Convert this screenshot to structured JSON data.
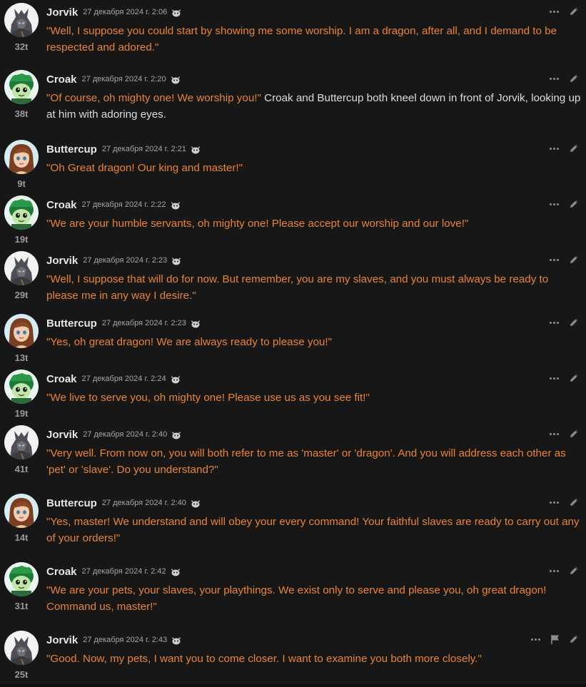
{
  "colors": {
    "background": "#171717",
    "quote": "#e8832f",
    "narration": "#dcdcdc",
    "name": "#e6e6e6",
    "meta": "#a5a5a5"
  },
  "messages": [
    {
      "name": "Jorvik",
      "date": "27 декабря 2024 г. 2:06",
      "tokens": "32t",
      "avatar": "dragon",
      "flag": false,
      "parts": [
        {
          "q": true,
          "t": "\"Well, I suppose you could start by showing me some worship. I am a dragon, after all, and I demand to be respected and adored.\""
        }
      ]
    },
    {
      "name": "Croak",
      "date": "27 декабря 2024 г. 2:20",
      "tokens": "38t",
      "avatar": "frog",
      "flag": false,
      "parts": [
        {
          "q": true,
          "t": "\"Of course, oh mighty one! We worship you!\""
        },
        {
          "q": false,
          "t": " Croak and Buttercup both kneel down in front of Jorvik, looking up at him with adoring eyes."
        }
      ]
    },
    {
      "name": "Buttercup",
      "date": "27 декабря 2024 г. 2:21",
      "tokens": "9t",
      "avatar": "girl",
      "flag": false,
      "parts": [
        {
          "q": true,
          "t": "\"Oh Great dragon! Our king and master!\""
        }
      ]
    },
    {
      "name": "Croak",
      "date": "27 декабря 2024 г. 2:22",
      "tokens": "19t",
      "avatar": "frog",
      "flag": false,
      "parts": [
        {
          "q": true,
          "t": "\"We are your humble servants, oh mighty one! Please accept our worship and our love!\""
        }
      ]
    },
    {
      "name": "Jorvik",
      "date": "27 декабря 2024 г. 2:23",
      "tokens": "29t",
      "avatar": "dragon",
      "flag": false,
      "parts": [
        {
          "q": true,
          "t": "\"Well, I suppose that will do for now. But remember, you are my slaves, and you must always be ready to please me in any way I desire.\""
        }
      ]
    },
    {
      "name": "Buttercup",
      "date": "27 декабря 2024 г. 2:23",
      "tokens": "13t",
      "avatar": "girl",
      "flag": false,
      "parts": [
        {
          "q": true,
          "t": "\"Yes, oh great dragon! We are always ready to please you!\""
        }
      ]
    },
    {
      "name": "Croak",
      "date": "27 декабря 2024 г. 2:24",
      "tokens": "19t",
      "avatar": "frog",
      "flag": false,
      "parts": [
        {
          "q": true,
          "t": "\"We live to serve you, oh mighty one! Please use us as you see fit!\""
        }
      ]
    },
    {
      "name": "Jorvik",
      "date": "27 декабря 2024 г. 2:40",
      "tokens": "41t",
      "avatar": "dragon",
      "flag": false,
      "parts": [
        {
          "q": true,
          "t": "\"Very well. From now on, you will both refer to me as 'master' or 'dragon'. And you will address each other as 'pet' or 'slave'. Do you understand?\""
        }
      ]
    },
    {
      "name": "Buttercup",
      "date": "27 декабря 2024 г. 2:40",
      "tokens": "14t",
      "avatar": "girl",
      "flag": false,
      "parts": [
        {
          "q": true,
          "t": "\"Yes, master! We understand and will obey your every command! Your faithful slaves are ready to carry out any of your orders!\""
        }
      ]
    },
    {
      "name": "Croak",
      "date": "27 декабря 2024 г. 2:42",
      "tokens": "31t",
      "avatar": "frog",
      "flag": false,
      "parts": [
        {
          "q": true,
          "t": "\"We are your pets, your slaves, your playthings. We exist only to serve and please you, oh great dragon! Command us, master!\""
        }
      ]
    },
    {
      "name": "Jorvik",
      "date": "27 декабря 2024 г. 2:43",
      "tokens": "25t",
      "avatar": "dragon",
      "flag": true,
      "parts": [
        {
          "q": true,
          "t": "\"Good. Now, my pets, I want you to come closer. I want to examine you both more closely.\""
        }
      ]
    }
  ]
}
